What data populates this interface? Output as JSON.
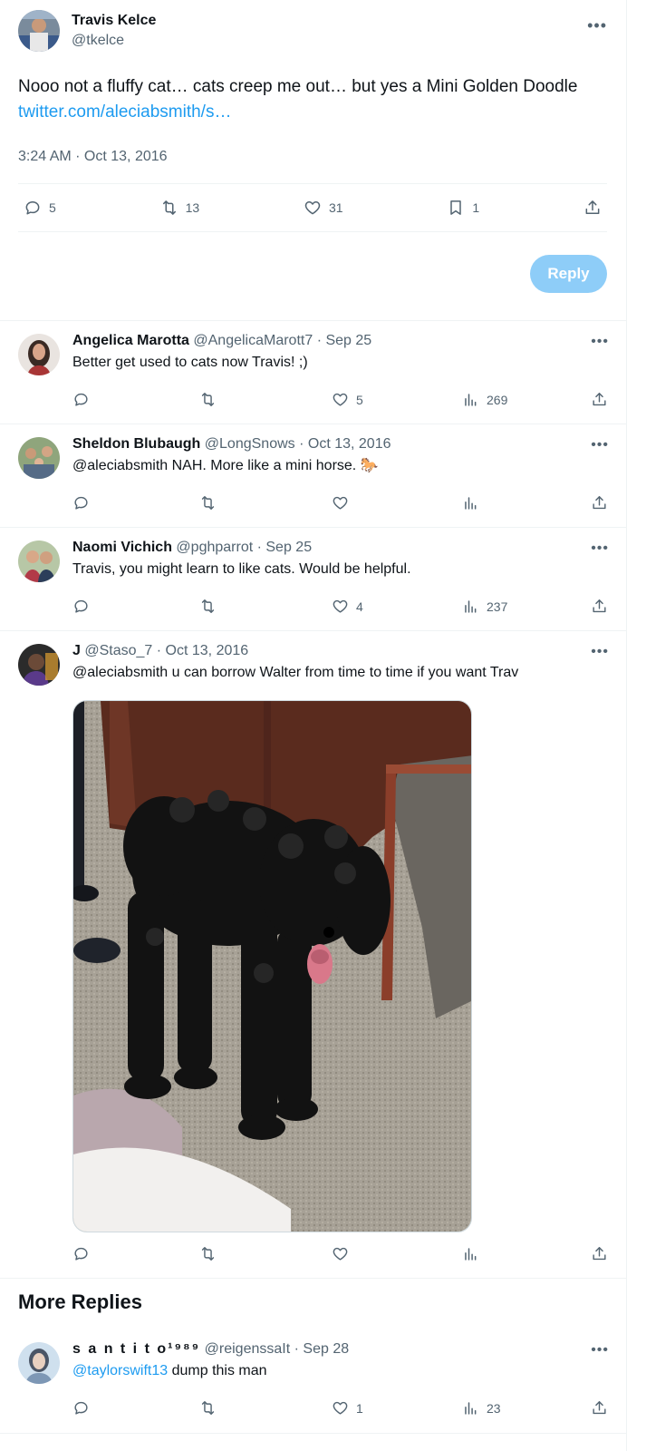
{
  "main_tweet": {
    "author_name": "Travis Kelce",
    "author_handle": "@tkelce",
    "text": "Nooo not a fluffy cat… cats creep me out… but yes a Mini Golden Doodle",
    "link": "twitter.com/aleciabsmith/s…",
    "timestamp": "3:24 AM · Oct 13, 2016",
    "replies": "5",
    "retweets": "13",
    "likes": "31",
    "bookmarks": "1",
    "reply_button": "Reply"
  },
  "replies": [
    {
      "name": "Angelica Marotta",
      "handle": "@AngelicaMarott7",
      "date": "· Sep 25",
      "text": "Better get used to cats now Travis! ;)",
      "likes": "5",
      "views": "269"
    },
    {
      "name": "Sheldon Blubaugh",
      "handle": "@LongSnows",
      "date": "· Oct 13, 2016",
      "text": "@aleciabsmith NAH. More like a mini horse. 🐎",
      "likes": "",
      "views": ""
    },
    {
      "name": "Naomi Vichich",
      "handle": "@pghparrot",
      "date": "· Sep 25",
      "text": "Travis, you might learn to like cats. Would be helpful.",
      "likes": "4",
      "views": "237"
    },
    {
      "name": "J",
      "handle": "@Staso_7",
      "date": "· Oct 13, 2016",
      "text": "@aleciabsmith u can borrow Walter from time to time if you want Trav",
      "likes": "",
      "views": ""
    }
  ],
  "more_replies": {
    "heading": "More Replies",
    "reply": {
      "name": "s a n t i t o¹⁹⁸⁹",
      "handle": "@reigenssaIt",
      "date": "· Sep 28",
      "mention": "@taylorswift13",
      "text": " dump this man",
      "likes": "1",
      "views": "23"
    }
  },
  "colors": {
    "accent": "#1d9bf0",
    "secondary_text": "#536471",
    "reply_button_disabled": "#8ecdf8",
    "divider": "#eff3f4"
  }
}
